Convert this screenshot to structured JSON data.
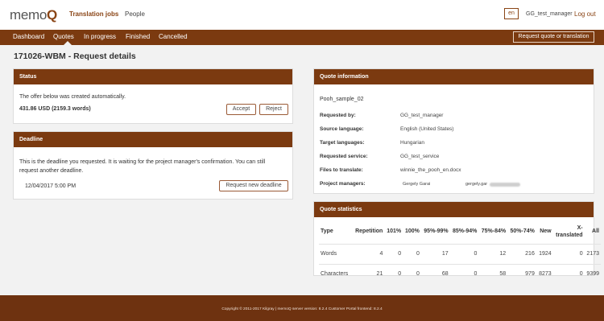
{
  "logo": {
    "prefix": "memo",
    "accent": "Q"
  },
  "topnav": {
    "jobs": "Translation jobs",
    "people": "People"
  },
  "header_right": {
    "lang": "en",
    "user": "GG_test_manager",
    "logout": "Log out"
  },
  "menu": {
    "items": [
      "Dashboard",
      "Quotes",
      "In progress",
      "Finished",
      "Cancelled"
    ],
    "active_index": 1,
    "request_button": "Request quote or translation"
  },
  "page_title": "171026-WBM - Request details",
  "status": {
    "title": "Status",
    "message": "The offer below was created automatically.",
    "amount": "431.86 USD (2159.3 words)",
    "accept": "Accept",
    "reject": "Reject"
  },
  "deadline": {
    "title": "Deadline",
    "message_line1": "This is the deadline you requested. It is waiting for the project manager's confirmation. You can still",
    "message_line2": "request another deadline.",
    "date": "12/04/2017 5:00 PM",
    "button": "Request new deadline"
  },
  "quote_info": {
    "title": "Quote information",
    "name": "Pooh_sample_02",
    "rows": [
      {
        "label": "Requested by:",
        "value": "GG_test_manager"
      },
      {
        "label": "Source language:",
        "value": "English (United States)"
      },
      {
        "label": "Target languages:",
        "value": "Hungarian"
      },
      {
        "label": "Requested service:",
        "value": "GG_test_service"
      },
      {
        "label": "Files to translate:",
        "value": "winnie_the_pooh_en.docx"
      }
    ],
    "pm_label": "Project managers:",
    "pm_name": "Gergely Garai",
    "pm_email": "gergely.gar"
  },
  "quote_stats": {
    "title": "Quote statistics",
    "headers": [
      "Type",
      "Repetition",
      "101%",
      "100%",
      "95%-99%",
      "85%-94%",
      "75%-84%",
      "50%-74%",
      "New",
      "X-translated",
      "All"
    ],
    "rows": [
      [
        "Words",
        "4",
        "0",
        "0",
        "17",
        "0",
        "12",
        "216",
        "1924",
        "0",
        "2173"
      ],
      [
        "Characters",
        "21",
        "0",
        "0",
        "68",
        "0",
        "58",
        "979",
        "8273",
        "0",
        "9399"
      ]
    ]
  },
  "footer": "Copyright © 2011-2017 Kilgray | memoQ server version: 8.2.4 Customer Portal frontend: 8.2.4",
  "colors": {
    "brand": "#7b3a10",
    "footer": "#6e3210",
    "accent_text": "#8a4516"
  }
}
